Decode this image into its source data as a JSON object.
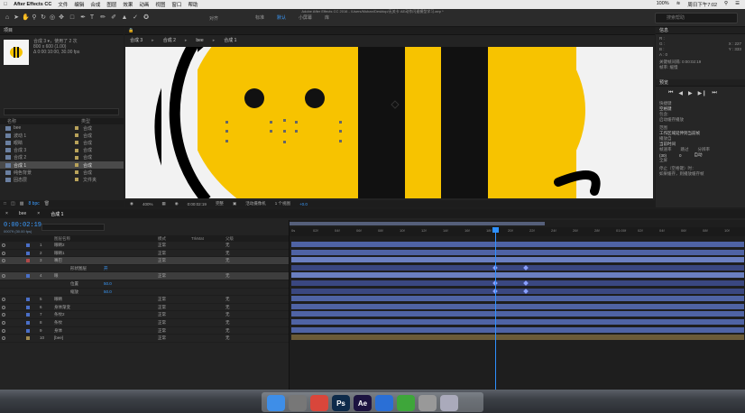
{
  "menubar": {
    "app_name": "After Effects CC",
    "items": [
      "文件",
      "编辑",
      "合成",
      "图层",
      "效果",
      "动画",
      "视图",
      "窗口",
      "帮助"
    ],
    "battery": "100%",
    "clock": "周日下午7:02"
  },
  "window_title": "Adobe After Effects CC 2016 - /Users/Muban/Desktop/无关卡 AE动作闪速模型学习.aep *",
  "toolbar": {
    "tools": [
      "home-icon",
      "select-arrow-icon",
      "hand-icon",
      "zoom-icon",
      "rotate-icon",
      "orbit-icon",
      "pan-behind-icon",
      "rectangle-icon",
      "pen-icon",
      "text-icon",
      "brush-icon",
      "clone-icon",
      "eraser-icon",
      "roto-icon",
      "puppet-icon"
    ],
    "align_label": "对齐",
    "workspaces": [
      "标准",
      "默认",
      "小屏幕",
      "库"
    ],
    "active_workspace": "默认",
    "search_placeholder": "搜索帮助"
  },
  "project": {
    "title": "项目",
    "selected_name": "合成 3 ▾，使用了 2 次",
    "selected_size": "800 x 600 (1.00)",
    "selected_duration": "Δ 0:00:10:00, 30.00 fps",
    "col_name": "名称",
    "col_type": "类型",
    "items": [
      {
        "name": "bee",
        "type": "合成"
      },
      {
        "name": "波动 1",
        "type": "合成"
      },
      {
        "name": "眼睛",
        "type": "合成"
      },
      {
        "name": "合成 3",
        "type": "合成"
      },
      {
        "name": "合成 2",
        "type": "合成"
      },
      {
        "name": "合成 1",
        "type": "合成",
        "selected": true
      },
      {
        "name": "纯色背景",
        "type": "合成"
      },
      {
        "name": "固态层",
        "type": "文件夹"
      }
    ],
    "bpc": "8 bpc"
  },
  "viewer": {
    "tabs": [
      "合成 3",
      "合成 2",
      "bee",
      "合成 1"
    ],
    "zoom": "400%",
    "timecode": "0:00:02:19",
    "quality": "完整",
    "camera": "活动摄像机",
    "views": "1 个视图",
    "exposure": "+0.0"
  },
  "info_panel": {
    "title": "信息",
    "r": "R :",
    "g": "G :",
    "b": "B :",
    "a": "A : 0",
    "x": "X : 227",
    "y": "Y : 333",
    "line1": "关键帧间隔: 0:00:02:19",
    "line2": "帧率: 缓慢"
  },
  "preview_panel": {
    "title": "预览"
  },
  "effects_panel": {
    "title": "快捷键",
    "shortcut": "空格键",
    "row1": "包含:",
    "row2": "启动缓存播放",
    "row3": "范围",
    "row4": "工作区域延伸到当前帧",
    "row5": "播放自",
    "row6": "当前时间",
    "frame_rate_label": "帧速率",
    "skip_label": "跳过",
    "resolution_label": "分辨率",
    "frame_rate": "(30)",
    "skip": "0",
    "resolution": "自动",
    "fullscreen": "全屏",
    "stop_label": "停止（空格键）时：",
    "stop_option": "如果缓存，则播放缓存帧"
  },
  "timeline": {
    "tabs": [
      "bee",
      "合成 1"
    ],
    "active_tab": "合成 1",
    "current_time": "0:00:02:19",
    "frames": "00079 (30.00 fps)",
    "col_layer": "图层名称",
    "col_mode": "模式",
    "col_trkmat": "TrkMat",
    "col_parent": "父级",
    "layers": [
      {
        "num": "1",
        "name": "眼睛2",
        "mode": "正常",
        "parent": "无",
        "color": "#4a6fc7"
      },
      {
        "num": "2",
        "name": "眼睛1",
        "mode": "正常",
        "parent": "无",
        "color": "#4a6fc7"
      },
      {
        "num": "3",
        "name": "嘴巴",
        "mode": "正常",
        "parent": "无",
        "color": "#b04848",
        "selected": true
      },
      {
        "num": "",
        "name": "形状图层",
        "mode": "",
        "parent": "",
        "color": "",
        "prop": true,
        "value": "开"
      },
      {
        "num": "4",
        "name": "眼",
        "mode": "正常",
        "parent": "无",
        "color": "#4a6fc7",
        "selected": true
      },
      {
        "num": "",
        "name": "位置",
        "mode": "",
        "parent": "",
        "color": "",
        "prop": true,
        "value": "50.0"
      },
      {
        "num": "",
        "name": "缩放",
        "mode": "",
        "parent": "",
        "color": "",
        "prop": true,
        "value": "50.0"
      },
      {
        "num": "5",
        "name": "眼睛",
        "mode": "正常",
        "parent": "无",
        "color": "#4a6fc7"
      },
      {
        "num": "6",
        "name": "身体渐变",
        "mode": "正常",
        "parent": "无",
        "color": "#4a6fc7"
      },
      {
        "num": "7",
        "name": "条纹2",
        "mode": "正常",
        "parent": "无",
        "color": "#4a6fc7"
      },
      {
        "num": "8",
        "name": "条纹",
        "mode": "正常",
        "parent": "无",
        "color": "#4a6fc7"
      },
      {
        "num": "9",
        "name": "身体",
        "mode": "正常",
        "parent": "无",
        "color": "#4a6fc7"
      },
      {
        "num": "10",
        "name": "[bee]",
        "mode": "正常",
        "parent": "无",
        "color": "#a08a50"
      }
    ],
    "ruler_ticks": [
      "0s",
      "02f",
      "04f",
      "06f",
      "08f",
      "10f",
      "12f",
      "14f",
      "16f",
      "18f",
      "20f",
      "22f",
      "24f",
      "26f",
      "28f",
      "01:00f",
      "02f",
      "04f",
      "06f",
      "08f",
      "10f"
    ]
  },
  "dock": {
    "apps": [
      {
        "name": "finder-icon",
        "label": "",
        "color": "#3e8ee8"
      },
      {
        "name": "launchpad-icon",
        "label": "",
        "color": "#777"
      },
      {
        "name": "chrome-icon",
        "label": "",
        "color": "#d9463b"
      },
      {
        "name": "photoshop-icon",
        "label": "Ps",
        "color": "#0d2a4a"
      },
      {
        "name": "aftereffects-icon",
        "label": "Ae",
        "color": "#1c1340"
      },
      {
        "name": "browser-icon",
        "label": "",
        "color": "#2a6fd6"
      },
      {
        "name": "evernote-icon",
        "label": "",
        "color": "#3ea63a"
      },
      {
        "name": "photos-icon",
        "label": "",
        "color": "#999"
      },
      {
        "name": "trash-icon",
        "label": "",
        "color": "#aab"
      }
    ]
  },
  "colors": {
    "accent": "#2e90ff",
    "bee_yellow": "#f7c300",
    "layer_bar": "#4f63a4"
  }
}
